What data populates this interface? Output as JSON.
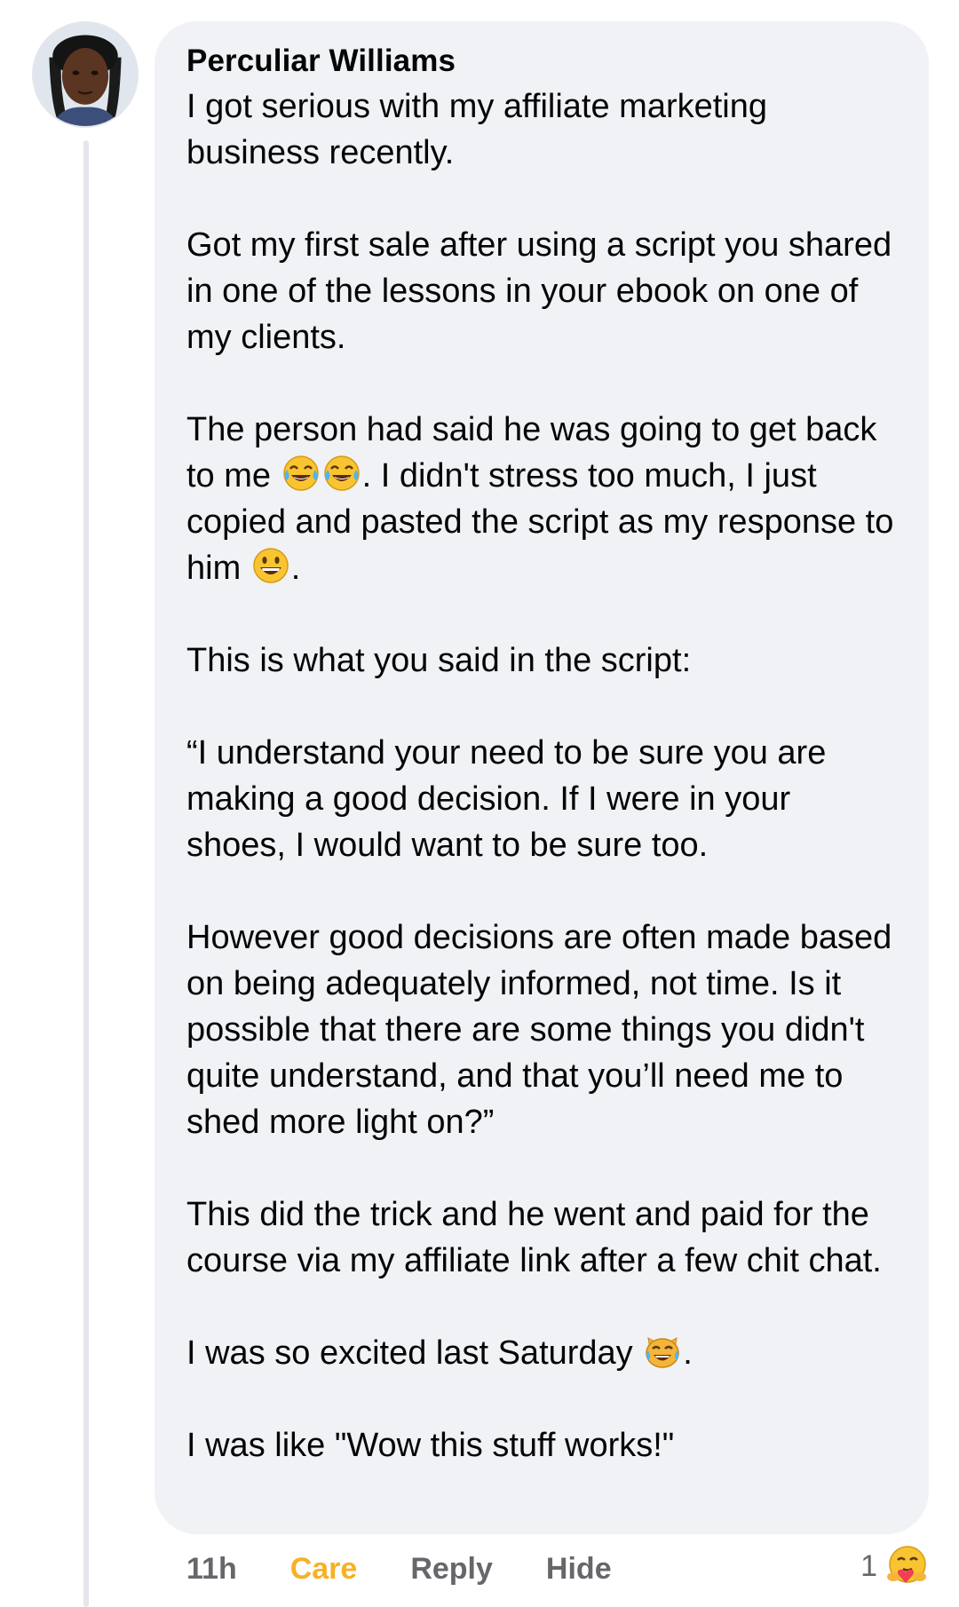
{
  "comment": {
    "author": "Perculiar Williams",
    "p1": "I got serious with my affiliate marketing business recently.",
    "p2": "Got my first sale after using a script you shared in one of the lessons in your ebook on one of my clients.",
    "p3_a": "The person had said he was going to get back to me ",
    "p3_b": ". I didn't stress too much, I just copied and pasted the script as my response to him ",
    "p3_c": ".",
    "p4": "This is what you said in the script:",
    "p5": "“I understand your need to be sure you are making a good decision. If I were in your shoes, I would want to be sure too.",
    "p6": "However good decisions are often made based on being adequately informed, not time. Is it possible that there are some things you didn't quite understand, and that you’ll need me to shed more light on?”",
    "p7": "This did the trick and he went and paid for the course via my affiliate link after a few chit chat.",
    "p8_a": "I was so excited last Saturday ",
    "p8_b": ".",
    "p9": "I was like \"Wow this stuff works!\""
  },
  "actions": {
    "time": "11h",
    "care": "Care",
    "reply": "Reply",
    "hide": "Hide"
  },
  "reaction": {
    "count": "1",
    "icon": "care-reaction-icon"
  },
  "colors": {
    "bubble": "#f0f2f5",
    "care": "#f7b125",
    "meta": "#65676b"
  }
}
